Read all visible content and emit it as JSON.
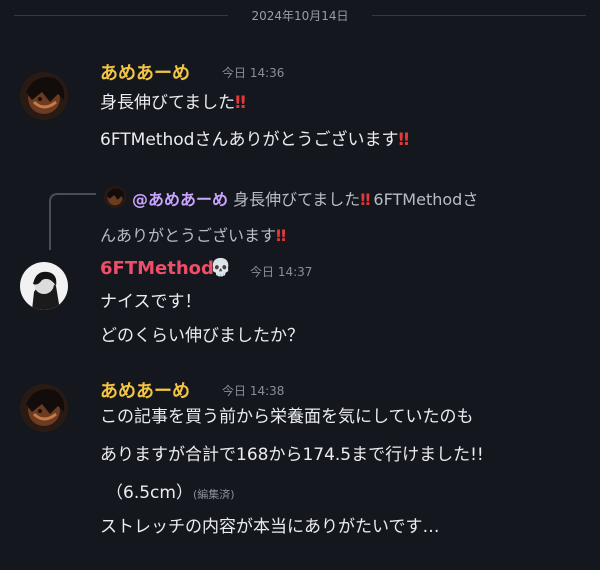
{
  "date_divider": "2024年10月14日",
  "messages": [
    {
      "author": "あめあーめ",
      "time": "今日 14:36",
      "lines": [
        "身長伸びてました",
        "6FTMethodさんありがとうございます"
      ],
      "emoji": "‼"
    },
    {
      "author": "6FTMethod",
      "time": "今日 14:37",
      "skull_emoji": "💀",
      "reply": {
        "author": "@あめあーめ",
        "text_line1": "身長伸びてました",
        "text_line1b": " 6FTMethodさ",
        "text_line2": "んありがとうございます"
      },
      "lines": [
        "ナイスです！",
        "どのくらい伸びましたか？"
      ]
    },
    {
      "author": "あめあーめ",
      "time": "今日 14:38",
      "lines": [
        "この記事を買う前から栄養面を気にしていたのも",
        "ありますが合計で168から174.5まで行けました!!",
        "（6.5cm）",
        "ストレッチの内容が本当にありがたいです…"
      ],
      "edited": "(編集済)"
    }
  ],
  "colors": {
    "background": "#15171e",
    "author_ame": "#f3c544",
    "author_6ft": "#ee4e68",
    "emoji_red": "#e23a3a"
  },
  "icons": [
    "avatar-ame",
    "avatar-6ftmethod",
    "reply-connector",
    "skull-emoji"
  ]
}
